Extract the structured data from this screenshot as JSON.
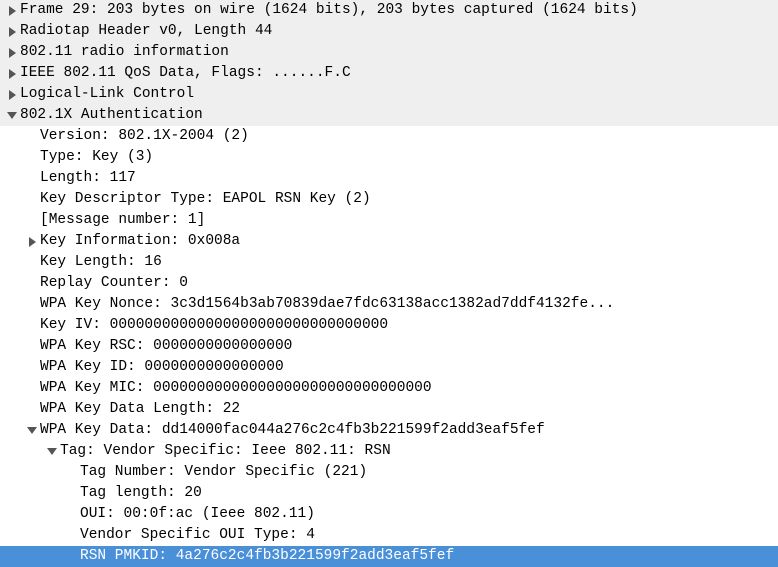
{
  "tree": {
    "frame_summary": "Frame 29: 203 bytes on wire (1624 bits), 203 bytes captured (1624 bits)",
    "radiotap": "Radiotap Header v0, Length 44",
    "radio_info": "802.11 radio information",
    "qos_data": "IEEE 802.11 QoS Data, Flags: ......F.C",
    "llc": "Logical-Link Control",
    "auth_header": "802.1X Authentication",
    "auth": {
      "version": "Version: 802.1X-2004 (2)",
      "type": "Type: Key (3)",
      "length": "Length: 117",
      "key_desc": "Key Descriptor Type: EAPOL RSN Key (2)",
      "msg_num": "[Message number: 1]",
      "key_info": "Key Information: 0x008a",
      "key_len": "Key Length: 16",
      "replay": "Replay Counter: 0",
      "nonce": "WPA Key Nonce: 3c3d1564b3ab70839dae7fdc63138acc1382ad7ddf4132fe...",
      "key_iv": "Key IV: 00000000000000000000000000000000",
      "key_rsc": "WPA Key RSC: 0000000000000000",
      "key_id": "WPA Key ID: 0000000000000000",
      "key_mic": "WPA Key MIC: 00000000000000000000000000000000",
      "data_len": "WPA Key Data Length: 22",
      "key_data": "WPA Key Data: dd14000fac044a276c2c4fb3b221599f2add3eaf5fef",
      "tag": {
        "header": "Tag: Vendor Specific: Ieee 802.11: RSN",
        "tag_num": "Tag Number: Vendor Specific (221)",
        "tag_len": "Tag length: 20",
        "oui": "OUI: 00:0f:ac (Ieee 802.11)",
        "oui_type": "Vendor Specific OUI Type: 4",
        "pmkid": "RSN PMKID: 4a276c2c4fb3b221599f2add3eaf5fef"
      }
    }
  }
}
